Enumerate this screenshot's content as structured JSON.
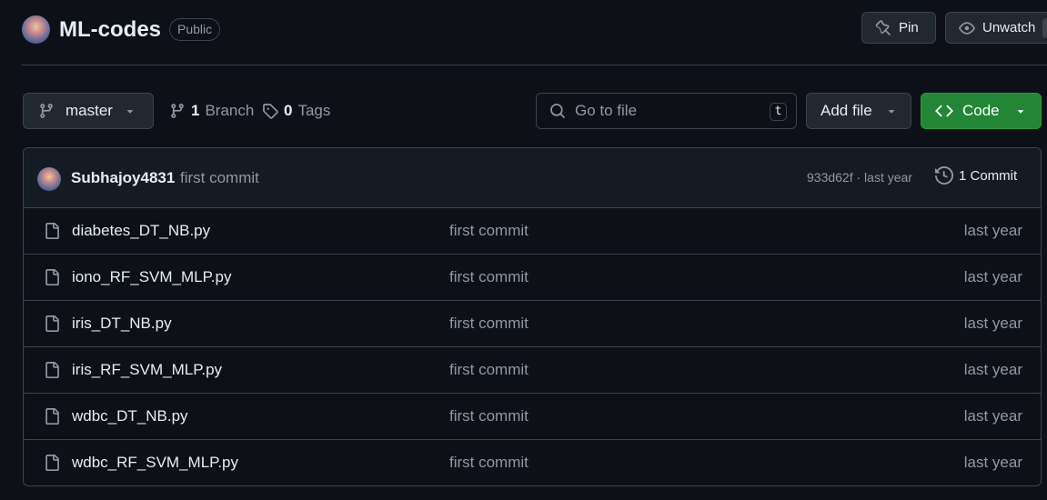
{
  "repo": {
    "name": "ML-codes",
    "visibility": "Public",
    "pin_label": "Pin",
    "watch_label": "Unwatch"
  },
  "toolbar": {
    "branch": "master",
    "branch_count": "1",
    "branch_label": "Branch",
    "tag_count": "0",
    "tag_label": "Tags",
    "goto_placeholder": "Go to file",
    "goto_shortcut": "t",
    "add_file_label": "Add file",
    "code_label": "Code"
  },
  "latest_commit": {
    "author": "Subhajoy4831",
    "message": "first commit",
    "meta": "933d62f · last year",
    "count_label": "1 Commit"
  },
  "files": [
    {
      "name": "diabetes_DT_NB.py",
      "commit": "first commit",
      "age": "last year"
    },
    {
      "name": "iono_RF_SVM_MLP.py",
      "commit": "first commit",
      "age": "last year"
    },
    {
      "name": "iris_DT_NB.py",
      "commit": "first commit",
      "age": "last year"
    },
    {
      "name": "iris_RF_SVM_MLP.py",
      "commit": "first commit",
      "age": "last year"
    },
    {
      "name": "wdbc_DT_NB.py",
      "commit": "first commit",
      "age": "last year"
    },
    {
      "name": "wdbc_RF_SVM_MLP.py",
      "commit": "first commit",
      "age": "last year"
    }
  ],
  "colors": {
    "background": "#0d1117",
    "border": "#3d444d",
    "code_button": "#238636",
    "muted_text": "#9198a1"
  },
  "icons": [
    "avatar",
    "pin-icon",
    "eye-icon",
    "git-branch-icon",
    "tag-icon",
    "search-icon",
    "caret-down-icon",
    "code-icon",
    "history-icon",
    "file-icon"
  ]
}
